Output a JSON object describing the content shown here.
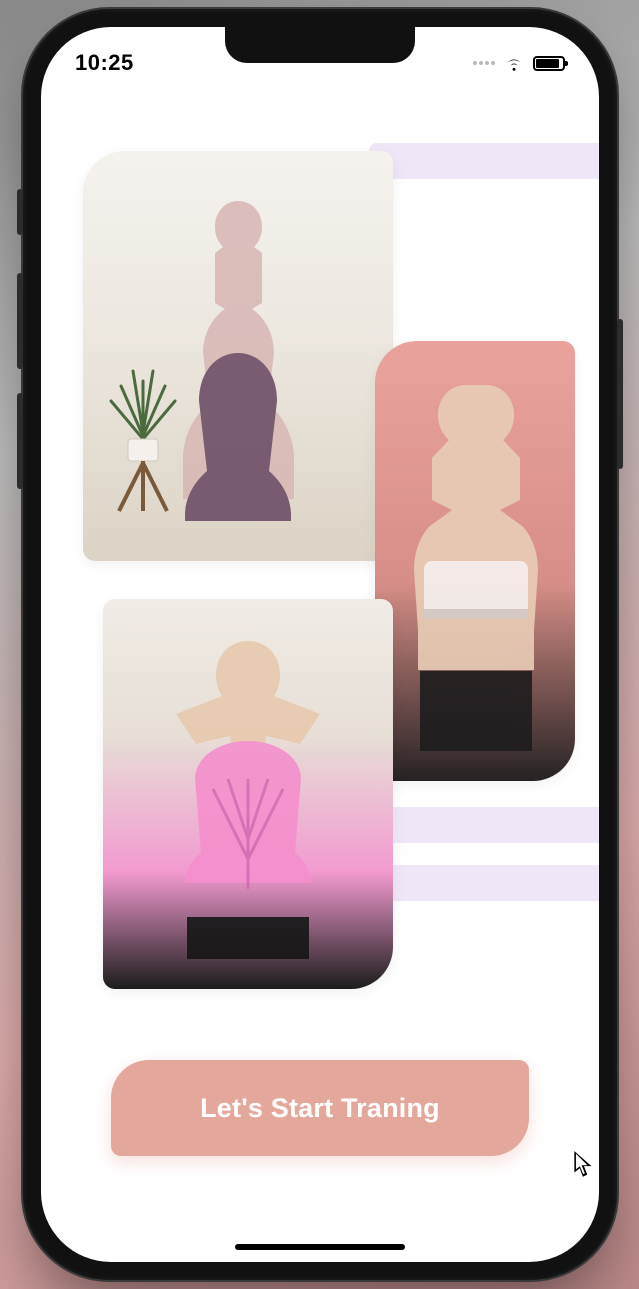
{
  "status_bar": {
    "time": "10:25",
    "icons": {
      "cellular": "cellular-dots-icon",
      "wifi": "wifi-icon",
      "battery": "battery-icon"
    }
  },
  "images": {
    "top": {
      "alt": "yoga-eagle-pose-photo"
    },
    "right": {
      "alt": "fitness-portrait-photo"
    },
    "bottom": {
      "alt": "back-stretch-photo"
    }
  },
  "cta": {
    "label": "Let's Start Traning"
  },
  "colors": {
    "accent": "#e4a79b",
    "stripe": "#efe6f7"
  }
}
